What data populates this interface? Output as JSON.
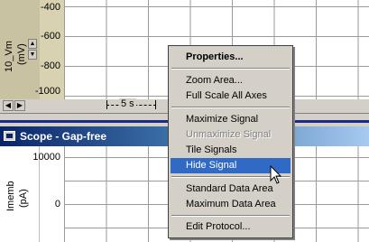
{
  "upper_panel": {
    "y_label": "10_Vm\n(mV)",
    "y_label_line1": "10_Vm",
    "y_label_line2": "(mV)",
    "ticks": [
      "-400",
      "-600",
      "-800",
      "-1000"
    ],
    "timescale": "5 s"
  },
  "scope_window": {
    "title": "Scope - Gap-free"
  },
  "lower_panel": {
    "y_label_line1": "Imemb",
    "y_label_line2": "(pA)",
    "ticks": [
      "10000",
      "0"
    ]
  },
  "context_menu": {
    "items": [
      {
        "label": "Properties...",
        "state": "bold"
      },
      {
        "label": "Zoom Area...",
        "state": "normal"
      },
      {
        "label": "Full Scale All Axes",
        "state": "normal"
      },
      {
        "label": "Maximize Signal",
        "state": "normal"
      },
      {
        "label": "Unmaximize Signal",
        "state": "disabled"
      },
      {
        "label": "Tile Signals",
        "state": "normal"
      },
      {
        "label": "Hide Signal",
        "state": "highlighted"
      },
      {
        "label": "Standard Data Area",
        "state": "normal"
      },
      {
        "label": "Maximum Data Area",
        "state": "normal"
      },
      {
        "label": "Edit Protocol...",
        "state": "normal"
      }
    ]
  },
  "icons": {
    "spin_up": "triangle-up-icon",
    "spin_down": "triangle-down-icon",
    "scroll_left": "arrow-left-icon",
    "scroll_right": "arrow-right-icon",
    "window": "scope-window-icon",
    "cursor": "mouse-pointer-icon"
  },
  "colors": {
    "highlight": "#316ac5",
    "titlebar_start": "#0a246a",
    "titlebar_end": "#a6caf0",
    "axis_strip": "#c9c2a2"
  }
}
